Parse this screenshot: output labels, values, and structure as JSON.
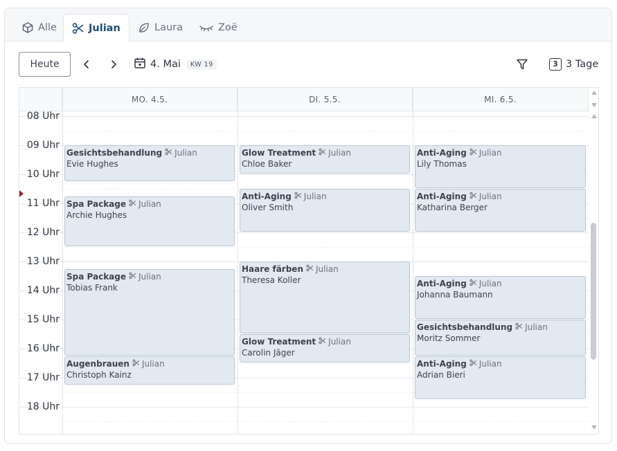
{
  "tabs": [
    {
      "label": "Alle",
      "icon": "cube-icon"
    },
    {
      "label": "Julian",
      "icon": "scissors-icon"
    },
    {
      "label": "Laura",
      "icon": "leaf-icon"
    },
    {
      "label": "Zoë",
      "icon": "eyelash-icon"
    }
  ],
  "toolbar": {
    "today": "Heute",
    "date": "4. Mai",
    "week": "KW 19",
    "view_count": "3",
    "view_label": "3 Tage"
  },
  "days": [
    "MO. 4.5.",
    "DI. 5.5.",
    "MI. 6.5."
  ],
  "hours": [
    "08 Uhr",
    "09 Uhr",
    "10 Uhr",
    "11 Uhr",
    "12 Uhr",
    "13 Uhr",
    "14 Uhr",
    "15 Uhr",
    "16 Uhr",
    "17 Uhr",
    "18 Uhr"
  ],
  "events": [
    {
      "day": 0,
      "start": "09:00",
      "end": "10:15",
      "title": "Gesichtsbehandlung",
      "staff": "Julian",
      "client": "Evie Hughes"
    },
    {
      "day": 0,
      "start": "10:45",
      "end": "12:30",
      "title": "Spa Package",
      "staff": "Julian",
      "client": "Archie Hughes"
    },
    {
      "day": 0,
      "start": "13:15",
      "end": "16:15",
      "title": "Spa Package",
      "staff": "Julian",
      "client": "Tobias Frank"
    },
    {
      "day": 0,
      "start": "16:15",
      "end": "17:15",
      "title": "Augenbrauen",
      "staff": "Julian",
      "client": "Christoph Kainz"
    },
    {
      "day": 1,
      "start": "09:00",
      "end": "10:00",
      "title": "Glow Treatment",
      "staff": "Julian",
      "client": "Chloe Baker"
    },
    {
      "day": 1,
      "start": "10:30",
      "end": "12:00",
      "title": "Anti-Aging",
      "staff": "Julian",
      "client": "Oliver Smith"
    },
    {
      "day": 1,
      "start": "13:00",
      "end": "15:30",
      "title": "Haare färben",
      "staff": "Julian",
      "client": "Theresa Koller"
    },
    {
      "day": 1,
      "start": "15:30",
      "end": "16:30",
      "title": "Glow Treatment",
      "staff": "Julian",
      "client": "Carolin Jäger"
    },
    {
      "day": 2,
      "start": "09:00",
      "end": "10:30",
      "title": "Anti-Aging",
      "staff": "Julian",
      "client": "Lily Thomas"
    },
    {
      "day": 2,
      "start": "10:30",
      "end": "12:00",
      "title": "Anti-Aging",
      "staff": "Julian",
      "client": "Katharina Berger"
    },
    {
      "day": 2,
      "start": "13:30",
      "end": "15:00",
      "title": "Anti-Aging",
      "staff": "Julian",
      "client": "Johanna Baumann"
    },
    {
      "day": 2,
      "start": "15:00",
      "end": "16:15",
      "title": "Gesichtsbehandlung",
      "staff": "Julian",
      "client": "Moritz Sommer"
    },
    {
      "day": 2,
      "start": "16:15",
      "end": "17:45",
      "title": "Anti-Aging",
      "staff": "Julian",
      "client": "Adrian Bieri"
    }
  ],
  "current_time": "10:40",
  "colors": {
    "accent": "#1d4f7c",
    "event_bg": "#e3e9f0",
    "event_border": "#b8c7d6",
    "now_marker": "#a31c2b"
  }
}
